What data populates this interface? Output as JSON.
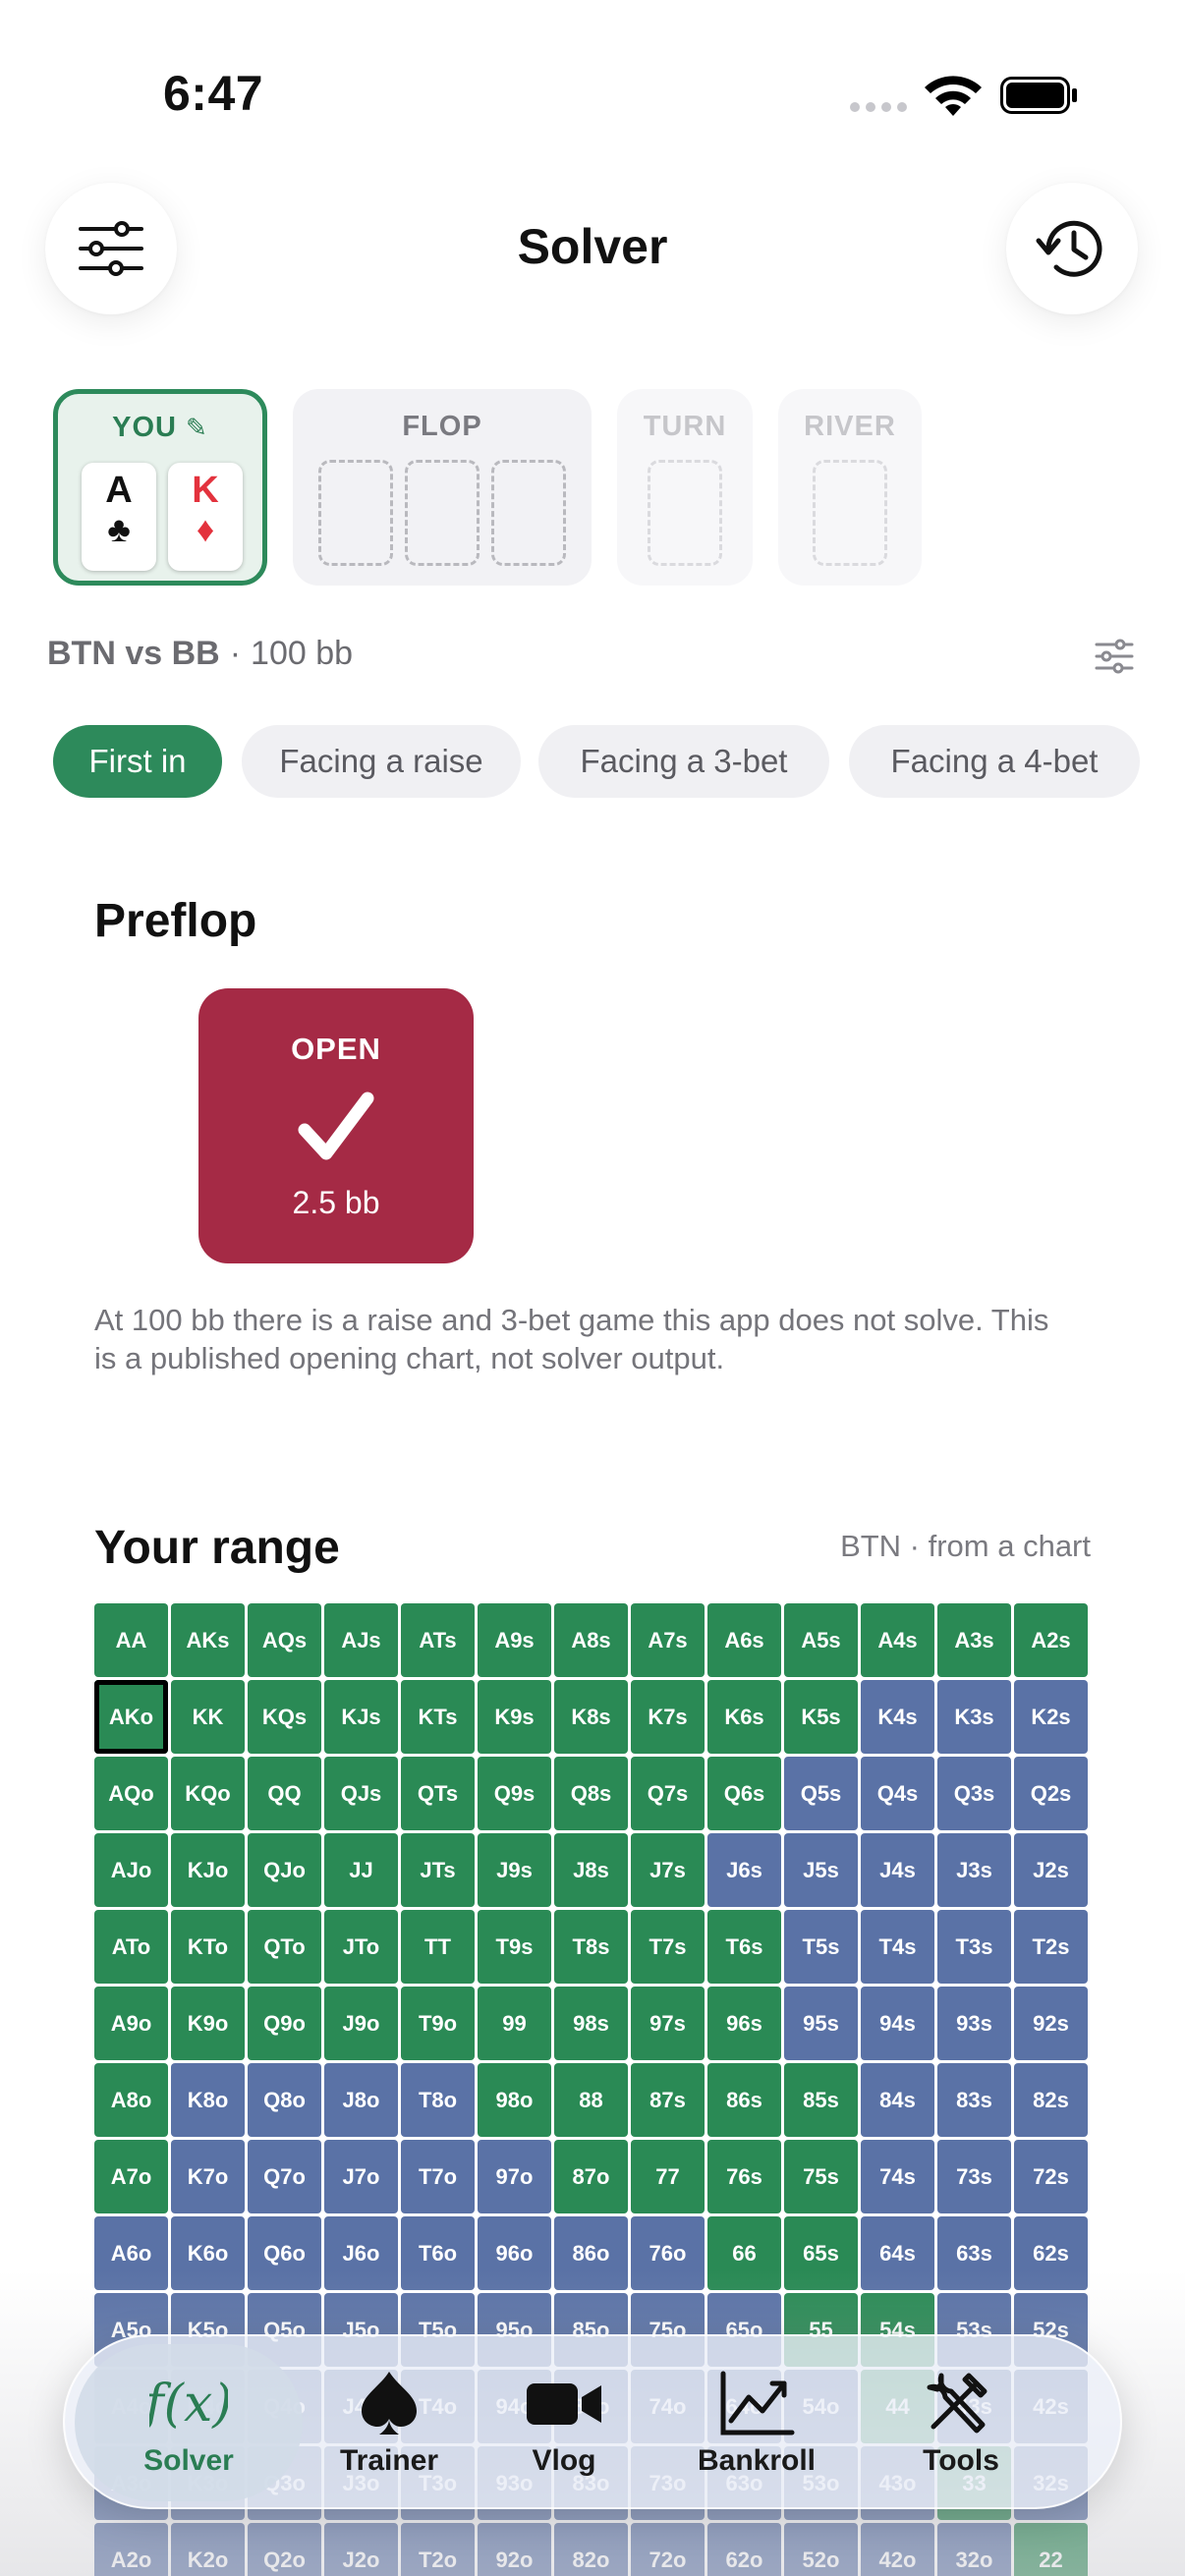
{
  "status": {
    "time": "6:47"
  },
  "header": {
    "title": "Solver"
  },
  "hand": {
    "you_label": "YOU",
    "cards": [
      {
        "rank": "A",
        "suit": "♣"
      },
      {
        "rank": "K",
        "suit": "♦"
      }
    ],
    "flop_label": "FLOP",
    "turn_label": "TURN",
    "river_label": "RIVER"
  },
  "spot": {
    "positions": "BTN vs BB",
    "stack": "100 bb"
  },
  "pills": [
    "First in",
    "Facing a raise",
    "Facing a 3-bet",
    "Facing a 4-bet"
  ],
  "preflop": {
    "title": "Preflop",
    "action": "OPEN",
    "size": "2.5 bb",
    "note": "At 100 bb there is a raise and 3-bet game this app does not solve. This is a published opening chart, not solver output."
  },
  "range": {
    "title": "Your range",
    "subtitle": "BTN · from a chart",
    "selected": "AKo",
    "rows": [
      [
        "AA",
        "AKs",
        "AQs",
        "AJs",
        "ATs",
        "A9s",
        "A8s",
        "A7s",
        "A6s",
        "A5s",
        "A4s",
        "A3s",
        "A2s"
      ],
      [
        "AKo",
        "KK",
        "KQs",
        "KJs",
        "KTs",
        "K9s",
        "K8s",
        "K7s",
        "K6s",
        "K5s",
        "K4s",
        "K3s",
        "K2s"
      ],
      [
        "AQo",
        "KQo",
        "QQ",
        "QJs",
        "QTs",
        "Q9s",
        "Q8s",
        "Q7s",
        "Q6s",
        "Q5s",
        "Q4s",
        "Q3s",
        "Q2s"
      ],
      [
        "AJo",
        "KJo",
        "QJo",
        "JJ",
        "JTs",
        "J9s",
        "J8s",
        "J7s",
        "J6s",
        "J5s",
        "J4s",
        "J3s",
        "J2s"
      ],
      [
        "ATo",
        "KTo",
        "QTo",
        "JTo",
        "TT",
        "T9s",
        "T8s",
        "T7s",
        "T6s",
        "T5s",
        "T4s",
        "T3s",
        "T2s"
      ],
      [
        "A9o",
        "K9o",
        "Q9o",
        "J9o",
        "T9o",
        "99",
        "98s",
        "97s",
        "96s",
        "95s",
        "94s",
        "93s",
        "92s"
      ],
      [
        "A8o",
        "K8o",
        "Q8o",
        "J8o",
        "T8o",
        "98o",
        "88",
        "87s",
        "86s",
        "85s",
        "84s",
        "83s",
        "82s"
      ],
      [
        "A7o",
        "K7o",
        "Q7o",
        "J7o",
        "T7o",
        "97o",
        "87o",
        "77",
        "76s",
        "75s",
        "74s",
        "73s",
        "72s"
      ],
      [
        "A6o",
        "K6o",
        "Q6o",
        "J6o",
        "T6o",
        "96o",
        "86o",
        "76o",
        "66",
        "65s",
        "64s",
        "63s",
        "62s"
      ],
      [
        "A5o",
        "K5o",
        "Q5o",
        "J5o",
        "T5o",
        "95o",
        "85o",
        "75o",
        "65o",
        "55",
        "54s",
        "53s",
        "52s"
      ],
      [
        "A4o",
        "K4o",
        "Q4o",
        "J4o",
        "T4o",
        "94o",
        "84o",
        "74o",
        "64o",
        "54o",
        "44",
        "43s",
        "42s"
      ],
      [
        "A3o",
        "K3o",
        "Q3o",
        "J3o",
        "T3o",
        "93o",
        "83o",
        "73o",
        "63o",
        "53o",
        "43o",
        "33",
        "32s"
      ],
      [
        "A2o",
        "K2o",
        "Q2o",
        "J2o",
        "T2o",
        "92o",
        "82o",
        "72o",
        "62o",
        "52o",
        "42o",
        "32o",
        "22"
      ]
    ],
    "open_mask": [
      "1111111111111",
      "1111111111000",
      "1111111110000",
      "1111111100000",
      "1111111110000",
      "1111111110000",
      "1000011111000",
      "1000001111000",
      "0000000011000",
      "0000000001100",
      "0000000000100",
      "0000000000010",
      "0000000000001"
    ],
    "colors": {
      "open": "#2a8a55",
      "fold": "#5a72a6"
    }
  },
  "tabs": [
    {
      "label": "Solver",
      "icon": "function-icon",
      "active": true
    },
    {
      "label": "Trainer",
      "icon": "spade-icon"
    },
    {
      "label": "Vlog",
      "icon": "video-camera-icon"
    },
    {
      "label": "Bankroll",
      "icon": "chart-line-icon"
    },
    {
      "label": "Tools",
      "icon": "tools-icon"
    }
  ]
}
